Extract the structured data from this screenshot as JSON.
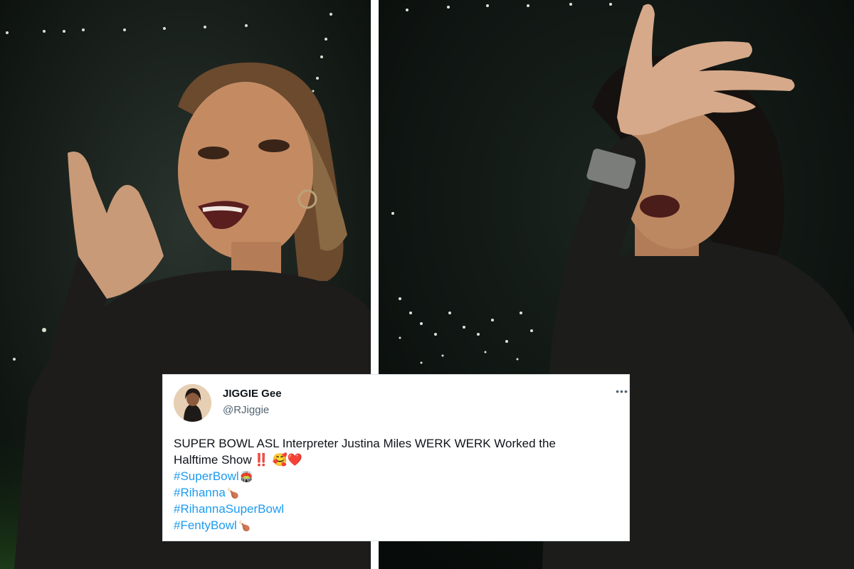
{
  "tweet": {
    "display_name": "JIGGIE Gee",
    "handle": "@RJiggie",
    "more_icon": "more-horizontal-icon",
    "text_line_1": "SUPER BOWL ASL  Interpreter Justina Miles WERK WERK Worked the",
    "text_line_2": "Halftime Show",
    "line_2_emojis": "‼️ 🥰❤️",
    "hashtags": [
      {
        "tag": "#SuperBowl",
        "emoji": "🏟️"
      },
      {
        "tag": "#Rihanna",
        "emoji": "🍗"
      },
      {
        "tag": "#RihannaSuperBowl",
        "emoji": ""
      },
      {
        "tag": "#FentyBowl",
        "emoji": "🍗"
      }
    ]
  },
  "colors": {
    "link": "#1d9bf0",
    "text": "#0f1419",
    "muted": "#536471",
    "background_dark": "#0d1310"
  }
}
